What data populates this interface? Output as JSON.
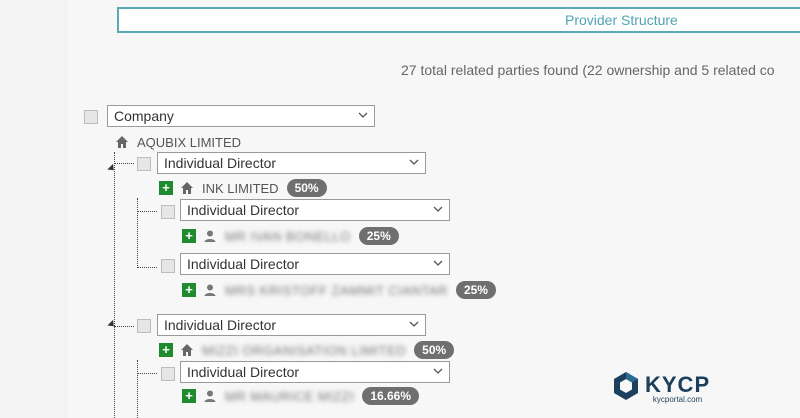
{
  "header": {
    "title": "Provider Structure"
  },
  "summary": {
    "text": "27 total related parties found (22 ownership and 5 related co"
  },
  "root": {
    "filter_value": "Company",
    "name": "AQUBIX LIMITED"
  },
  "groups": [
    {
      "filter_value": "Individual Director",
      "entity": {
        "name": "INK LIMITED",
        "percent": "50%",
        "icon": "home-icon"
      },
      "children": [
        {
          "filter_value": "Individual Director",
          "name": "MR IVAN BONELLO",
          "percent": "25%",
          "icon": "person-icon"
        },
        {
          "filter_value": "Individual Director",
          "name": "MRS KRISTOFF ZAMMIT CIANTAR",
          "percent": "25%",
          "icon": "person-icon"
        }
      ]
    },
    {
      "filter_value": "Individual Director",
      "entity": {
        "name": "MIZZI ORGANISATION LIMITED",
        "percent": "50%",
        "icon": "home-icon"
      },
      "children": [
        {
          "filter_value": "Individual Director",
          "name": "MR MAURICE MIZZI",
          "percent": "16.66%",
          "icon": "person-icon"
        }
      ]
    }
  ],
  "logo": {
    "main": "KYCP",
    "sub": "kycportal.com"
  },
  "colors": {
    "accent": "#4fa3b1",
    "plus": "#1f8a2e",
    "badge": "#6f6f6f",
    "logo": "#1b3f5c"
  }
}
